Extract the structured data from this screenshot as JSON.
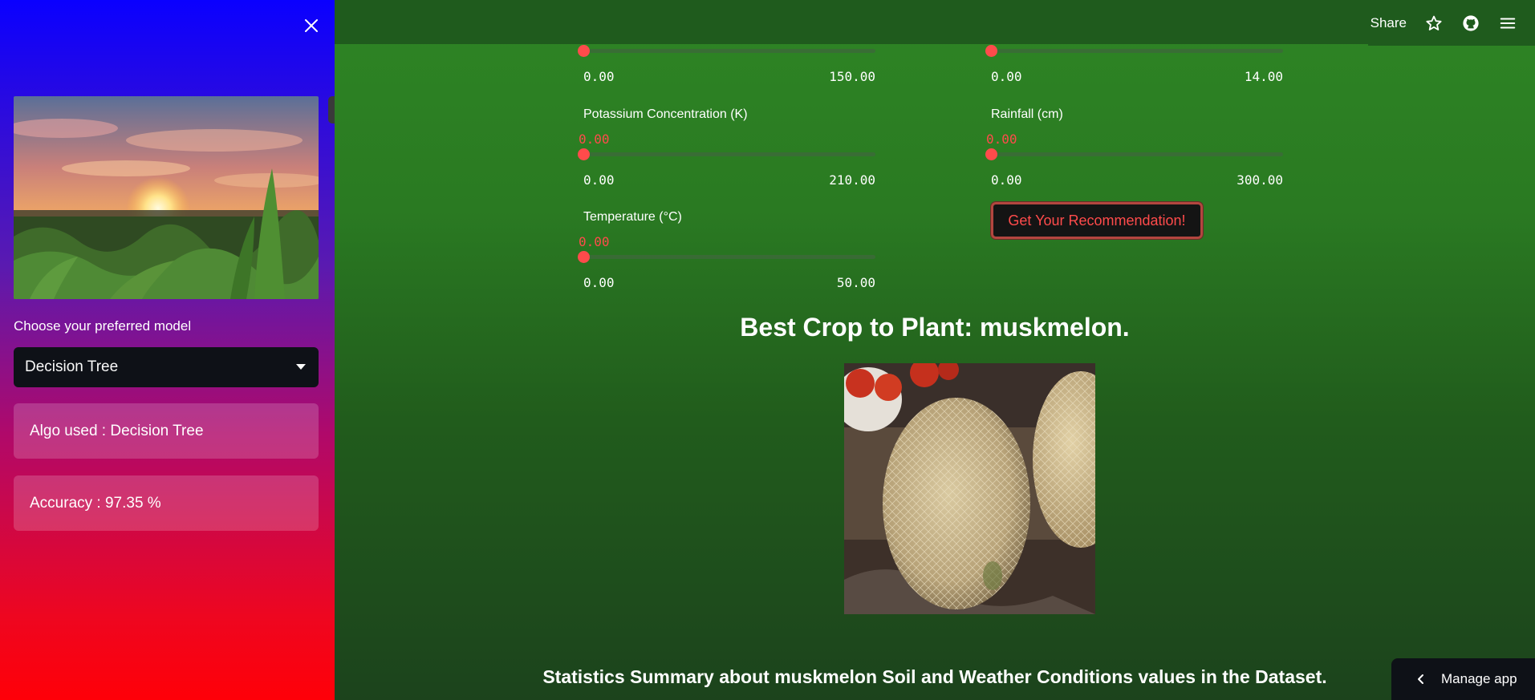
{
  "header": {
    "share_label": "Share",
    "icons": [
      "star-icon",
      "github-icon",
      "menu-icon"
    ]
  },
  "sidebar": {
    "model_label": "Choose your preferred model",
    "model_selected": "Decision Tree",
    "algo_text": "Algo used : Decision Tree",
    "accuracy_text": "Accuracy : 97.35 %"
  },
  "sliders": {
    "top_left": {
      "min": "0.00",
      "max": "150.00",
      "fraction": 0
    },
    "top_right": {
      "min": "0.00",
      "max": "14.00",
      "fraction": 0
    },
    "potassium": {
      "label": "Potassium Concentration (K)",
      "value": "0.00",
      "min": "0.00",
      "max": "210.00",
      "fraction": 0
    },
    "rainfall": {
      "label": "Rainfall (cm)",
      "value": "0.00",
      "min": "0.00",
      "max": "300.00",
      "fraction": 0
    },
    "temperature": {
      "label": "Temperature (°C)",
      "value": "0.00",
      "min": "0.00",
      "max": "50.00",
      "fraction": 0
    }
  },
  "main": {
    "recommend_button": "Get Your Recommendation!",
    "result_title": "Best Crop to Plant: muskmelon.",
    "stats_title": "Statistics Summary about muskmelon Soil and Weather Conditions values in the Dataset."
  },
  "footer": {
    "manage_app": "Manage app"
  },
  "colors": {
    "accent": "#ff4b4b",
    "main_bg": "#2a7a22",
    "sidebar_top": "#0a00ff",
    "sidebar_bottom": "#ff0008"
  }
}
